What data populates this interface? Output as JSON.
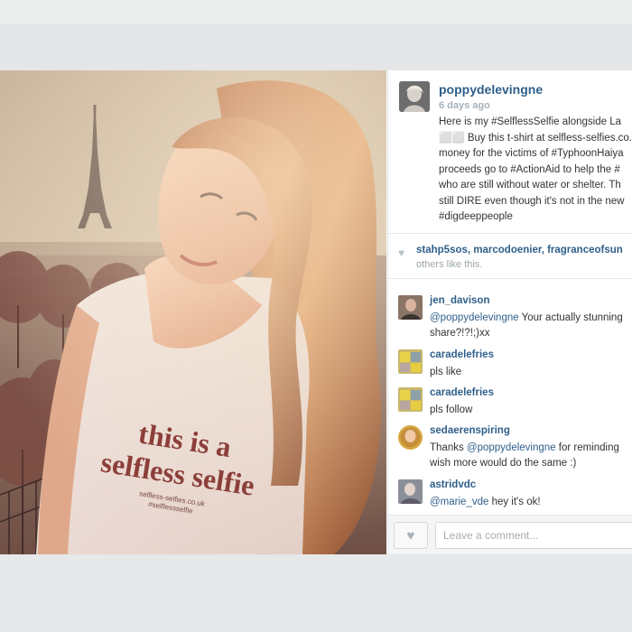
{
  "post": {
    "username": "poppydelevingne",
    "time": "6 days ago",
    "caption_lines": [
      "Here is my #SelflessSelfie alongside La",
      "⬜⬜ Buy this t-shirt at selfless-selfies.co.",
      "money for the victims of #TyphoonHaiya",
      "proceeds go to #ActionAid to help the #",
      "who are still without water or shelter. Th",
      "still DIRE even though it's not in the new",
      "#digdeeppeople"
    ]
  },
  "photo": {
    "shirt_line1": "this is a",
    "shirt_line2": "selfless selfie",
    "shirt_small1": "selfless-selfies.co.uk",
    "shirt_small2": "#selflessselfie"
  },
  "likes": {
    "names": "stahp5sos, marcodoenier, fragranceofsun",
    "others": "others like this."
  },
  "comments": [
    {
      "user": "jen_davison",
      "mention": "@poppydelevingne",
      "text_after_mention": " Your actually stunning",
      "line2": "share?!?!;)xx"
    },
    {
      "user": "caradelefries",
      "mention": "",
      "text_after_mention": "pls like",
      "line2": ""
    },
    {
      "user": "caradelefries",
      "mention": "",
      "text_after_mention": "pls follow",
      "line2": ""
    },
    {
      "user": "sedaerenspiring",
      "text_before": "Thanks ",
      "mention": "@poppydelevingne",
      "text_after_mention": " for reminding",
      "line2": "wish more would do the same :)"
    },
    {
      "user": "astridvdc",
      "mention": "@marie_vde",
      "text_after_mention": " hey it's ok!",
      "line2": ""
    }
  ],
  "comment_bar": {
    "placeholder": "Leave a comment..."
  },
  "colors": {
    "link": "#2f5f8a",
    "muted": "#a6b1ba"
  }
}
